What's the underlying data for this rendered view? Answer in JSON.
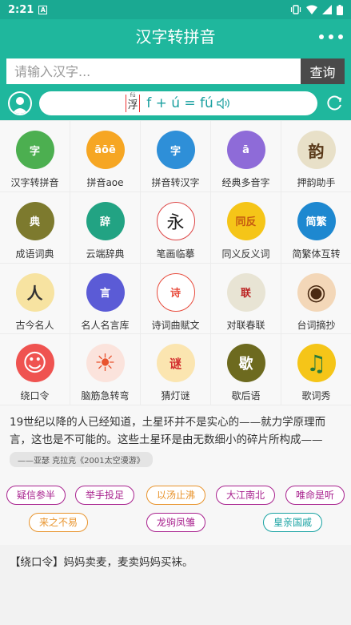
{
  "status_bar": {
    "time": "2:21",
    "badge": "A"
  },
  "app_bar": {
    "title": "汉字转拼音"
  },
  "search": {
    "placeholder": "请输入汉字...",
    "button_label": "查询"
  },
  "pinyin_demo": {
    "character": "浮",
    "character_pinyin": "fú",
    "formula": "f + ú = fú"
  },
  "features": [
    {
      "label": "汉字转拼音",
      "icon": "hanzi-to-pinyin-icon",
      "color": "#4caf50",
      "glyph": "字"
    },
    {
      "label": "拼音aoe",
      "icon": "pinyin-aoe-icon",
      "color": "#f6a623",
      "glyph": "āōē"
    },
    {
      "label": "拼音转汉字",
      "icon": "pinyin-to-hanzi-icon",
      "color": "#2e8fd8",
      "glyph": "字"
    },
    {
      "label": "经典多音字",
      "icon": "polyphonic-icon",
      "color": "#8e6bd8",
      "glyph": "ā"
    },
    {
      "label": "押韵助手",
      "icon": "rhyme-icon",
      "color": "#e8e0c8",
      "glyph": "韵"
    },
    {
      "label": "成语词典",
      "icon": "idiom-dictionary-icon",
      "color": "#7d7a2e",
      "glyph": "典"
    },
    {
      "label": "云端辞典",
      "icon": "cloud-dictionary-icon",
      "color": "#22a383",
      "glyph": "辞"
    },
    {
      "label": "笔画临摹",
      "icon": "stroke-copy-icon",
      "color": "#ffffff",
      "glyph": "永"
    },
    {
      "label": "同义反义词",
      "icon": "synonym-antonym-icon",
      "color": "#f5c518",
      "glyph": "同反"
    },
    {
      "label": "简繁体互转",
      "icon": "simplified-traditional-icon",
      "color": "#1e88d0",
      "glyph": "简繁"
    },
    {
      "label": "古今名人",
      "icon": "famous-people-icon",
      "color": "#f7e3a1",
      "glyph": "人"
    },
    {
      "label": "名人名言库",
      "icon": "famous-quotes-icon",
      "color": "#5b5bd6",
      "glyph": "言"
    },
    {
      "label": "诗词曲赋文",
      "icon": "poetry-icon",
      "color": "#e84c3d",
      "glyph": "诗"
    },
    {
      "label": "对联春联",
      "icon": "couplet-icon",
      "color": "#e8e4d4",
      "glyph": "联"
    },
    {
      "label": "台词摘抄",
      "icon": "film-quotes-icon",
      "color": "#f3d7b8",
      "glyph": "◉"
    },
    {
      "label": "绕口令",
      "icon": "tongue-twister-icon",
      "color": "#ef5350",
      "glyph": "☺"
    },
    {
      "label": "脑筋急转弯",
      "icon": "brain-teaser-icon",
      "color": "#fbe3dc",
      "glyph": "☀"
    },
    {
      "label": "猜灯谜",
      "icon": "lantern-riddle-icon",
      "color": "#fbe5b0",
      "glyph": "谜"
    },
    {
      "label": "歇后语",
      "icon": "xiehouyu-icon",
      "color": "#6d6a1f",
      "glyph": "歇"
    },
    {
      "label": "歌词秀",
      "icon": "lyrics-icon",
      "color": "#f5c518",
      "glyph": "♫"
    }
  ],
  "quote": {
    "text": "19世纪以降的人已经知道，土星环并不是实心的——就力学原理而言，这也是不可能的。这些土星环是由无数细小的碎片所构成——也...",
    "source": "——亚瑟 克拉克《2001太空漫游》"
  },
  "tags": [
    {
      "label": "疑信参半",
      "color": "#a8218e"
    },
    {
      "label": "举手投足",
      "color": "#a8218e"
    },
    {
      "label": "以汤止沸",
      "color": "#e8932b"
    },
    {
      "label": "大江南北",
      "color": "#a8218e"
    },
    {
      "label": "唯命是听",
      "color": "#a8218e"
    },
    {
      "label": "来之不易",
      "color": "#e8932b"
    },
    {
      "label": "龙驹凤雏",
      "color": "#a8218e"
    },
    {
      "label": "皇亲国戚",
      "color": "#17a2a2"
    }
  ],
  "tongue_twister": "【绕口令】妈妈卖麦，麦卖妈妈买袜。"
}
